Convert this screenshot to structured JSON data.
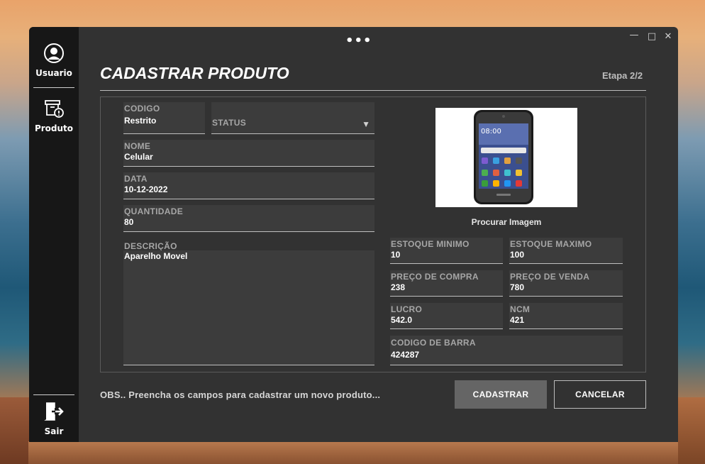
{
  "window": {
    "menu_dots": "•••"
  },
  "sidebar": {
    "usuario_label": "Usuario",
    "produto_label": "Produto",
    "sair_label": "Sair"
  },
  "header": {
    "title": "CADASTRAR PRODUTO",
    "step": "Etapa 2/2"
  },
  "form": {
    "codigo": {
      "label": "CODIGO",
      "value": "Restrito"
    },
    "status": {
      "label": "STATUS",
      "value": ""
    },
    "nome": {
      "label": "NOME",
      "value": "Celular"
    },
    "data": {
      "label": "DATA",
      "value": "10-12-2022"
    },
    "quantidade": {
      "label": "QUANTIDADE",
      "value": "80"
    },
    "descricao": {
      "label": "DESCRIÇÃO",
      "value": "Aparelho Movel"
    },
    "estoque_minimo": {
      "label": "ESTOQUE MINIMO",
      "value": "10"
    },
    "estoque_maximo": {
      "label": "ESTOQUE MAXIMO",
      "value": "100"
    },
    "preco_compra": {
      "label": "PREÇO DE COMPRA",
      "value": "238"
    },
    "preco_venda": {
      "label": "PREÇO DE VENDA",
      "value": "780"
    },
    "lucro": {
      "label": "LUCRO",
      "value": "542.0"
    },
    "ncm": {
      "label": "NCM",
      "value": "421"
    },
    "codigo_barra": {
      "label": "CODIGO DE BARRA",
      "value": "424287"
    }
  },
  "image": {
    "procurar_label": "Procurar Imagem",
    "icon": "smartphone-product-image"
  },
  "footer": {
    "obs": "OBS..  Preencha os campos para cadastrar um novo produto...",
    "cadastrar_label": "CADASTRAR",
    "cancelar_label": "CANCELAR"
  },
  "colors": {
    "window_bg": "#323232",
    "sidebar_bg": "#171717",
    "field_bg": "#3c3c3c",
    "primary_button": "#656565"
  }
}
